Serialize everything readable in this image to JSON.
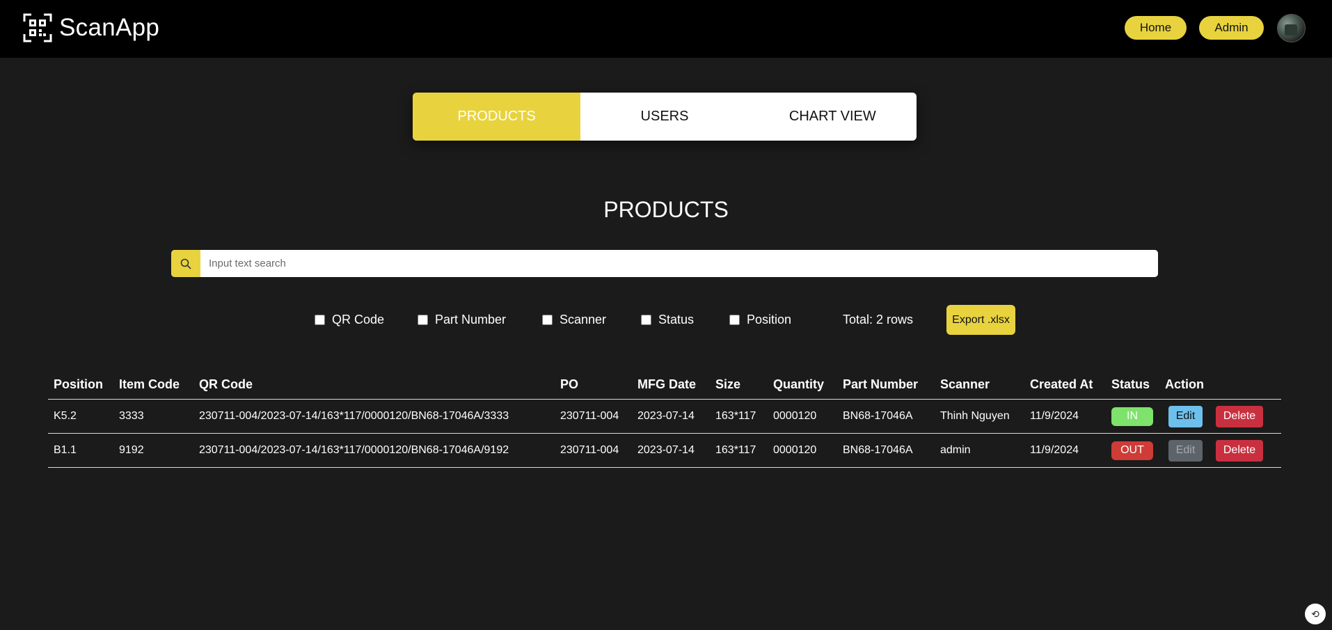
{
  "header": {
    "app_name": "ScanApp",
    "home_label": "Home",
    "admin_label": "Admin"
  },
  "tabs": [
    {
      "label": "PRODUCTS",
      "active": true
    },
    {
      "label": "USERS",
      "active": false
    },
    {
      "label": "CHART VIEW",
      "active": false
    }
  ],
  "page_title": "PRODUCTS",
  "search": {
    "placeholder": "Input text search"
  },
  "filters": [
    {
      "label": "QR Code",
      "checked": false
    },
    {
      "label": "Part Number",
      "checked": false
    },
    {
      "label": "Scanner",
      "checked": false
    },
    {
      "label": "Status",
      "checked": false
    },
    {
      "label": "Position",
      "checked": false
    }
  ],
  "total_label": "Total: 2 rows",
  "export_label": "Export .xlsx",
  "table": {
    "columns": [
      "Position",
      "Item Code",
      "QR Code",
      "PO",
      "MFG Date",
      "Size",
      "Quantity",
      "Part Number",
      "Scanner",
      "Created At",
      "Status",
      "Action"
    ],
    "rows": [
      {
        "position": "K5.2",
        "item_code": "3333",
        "qr_code": "230711-004/2023-07-14/163*117/0000120/BN68-17046A/3333",
        "po": "230711-004",
        "mfg_date": "2023-07-14",
        "size": "163*117",
        "quantity": "0000120",
        "part_number": "BN68-17046A",
        "scanner": "Thinh Nguyen",
        "created_at": "11/9/2024",
        "status": "IN",
        "edit_label": "Edit",
        "delete_label": "Delete"
      },
      {
        "position": "B1.1",
        "item_code": "9192",
        "qr_code": "230711-004/2023-07-14/163*117/0000120/BN68-17046A/9192",
        "po": "230711-004",
        "mfg_date": "2023-07-14",
        "size": "163*117",
        "quantity": "0000120",
        "part_number": "BN68-17046A",
        "scanner": "admin",
        "created_at": "11/9/2024",
        "status": "OUT",
        "edit_label": "Edit",
        "delete_label": "Delete"
      }
    ]
  },
  "colors": {
    "accent": "#e8d33f",
    "status_in": "#7ee36b",
    "status_out": "#cf3b36",
    "edit": "#6ec0ec",
    "delete": "#c9303f",
    "background": "#1b1b1b"
  },
  "icons": {
    "logo": "qr-scan-icon",
    "search": "search-icon",
    "corner": "translate-icon"
  }
}
